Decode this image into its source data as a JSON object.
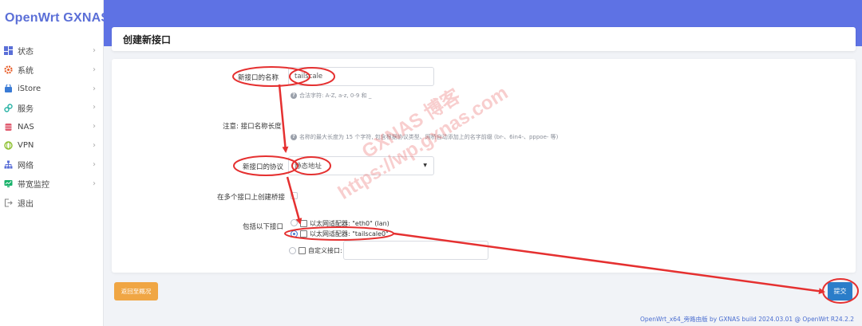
{
  "brand": "OpenWrt GXNAS",
  "sidebar": {
    "items": [
      {
        "label": "状态",
        "icon": "dashboard-icon",
        "color": "#5b6fd7"
      },
      {
        "label": "系统",
        "icon": "gear-icon",
        "color": "#e8602c"
      },
      {
        "label": "iStore",
        "icon": "store-icon",
        "color": "#3a7bd5"
      },
      {
        "label": "服务",
        "icon": "puzzle-icon",
        "color": "#2bb3a6"
      },
      {
        "label": "NAS",
        "icon": "nas-icon",
        "color": "#e05a6e"
      },
      {
        "label": "VPN",
        "icon": "vpn-icon",
        "color": "#8bbf2c"
      },
      {
        "label": "网络",
        "icon": "network-icon",
        "color": "#5b6fd7"
      },
      {
        "label": "带宽监控",
        "icon": "monitor-icon",
        "color": "#17b26a"
      },
      {
        "label": "退出",
        "icon": "logout-icon",
        "color": "#888888"
      }
    ]
  },
  "page": {
    "title": "创建新接口"
  },
  "form": {
    "name_label": "新接口的名称",
    "name_value": "tailscale",
    "name_hint": "合法字符: A-Z, a-z, 0-9 和 _",
    "note_label": "注意: 接口名称长度",
    "note_hint": "名称的最大长度为 15 个字符, 包含根据协议类型、网桥自动添加上的名字前缀 (br-、6in4-、pppoe- 等)",
    "protocol_label": "新接口的协议",
    "protocol_value": "静态地址",
    "bridge_label": "在多个接口上创建桥接",
    "include_label": "包括以下接口",
    "options": [
      {
        "text": "以太网适配器: \"eth0\" (lan)",
        "selected": false
      },
      {
        "text": "以太网适配器: \"tailscale0\"",
        "selected": true
      },
      {
        "text": "自定义接口:",
        "selected": false
      }
    ]
  },
  "buttons": {
    "back": "返回至概况",
    "submit": "提交"
  },
  "footer": "OpenWrt_x64_旁路由版 by GXNAS build 2024.03.01 @ OpenWrt R24.2.2",
  "watermark": {
    "line1": "GXNAS 博客",
    "line2": "https://wp.gxnas.com"
  },
  "colors": {
    "header": "#5e72e4",
    "accent": "#2a7dc9",
    "annotation": "#e53030"
  }
}
